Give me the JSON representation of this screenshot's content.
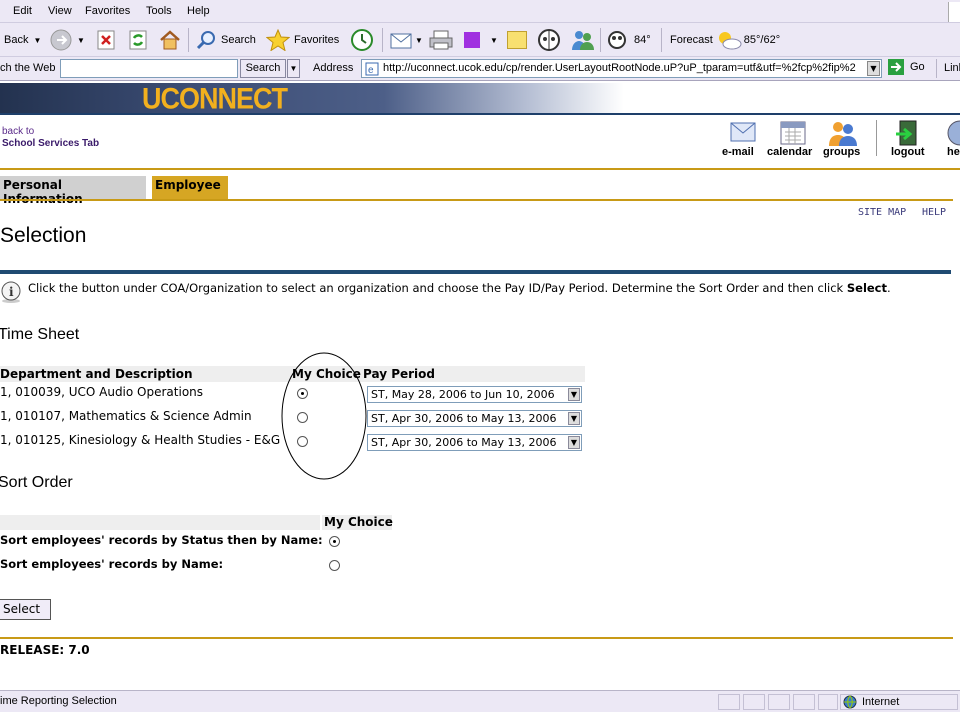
{
  "menu": [
    "Edit",
    "View",
    "Favorites",
    "Tools",
    "Help"
  ],
  "toolbar": {
    "back": "Back",
    "search": "Search",
    "favorites": "Favorites",
    "temp": "84°",
    "forecast": "Forecast",
    "forecast_temp": "85°/62°"
  },
  "addressbar": {
    "search_web": "ch the Web",
    "search_button": "Search",
    "address_label": "Address",
    "url": "http://uconnect.ucok.edu/cp/render.UserLayoutRootNode.uP?uP_tparam=utf&utf=%2fcp%2fip%2",
    "go": "Go",
    "links": "Link"
  },
  "banner": {
    "logo_text": "UCONNECT"
  },
  "back_link": {
    "line1": "back to",
    "line2": "School Services Tab"
  },
  "nav": [
    "e-mail",
    "calendar",
    "groups",
    "logout",
    "he"
  ],
  "tabs": [
    "Personal Information",
    "Employee"
  ],
  "top_links": {
    "site_map": "SITE MAP",
    "help": "HELP"
  },
  "page_title": "Selection",
  "info": {
    "text": "Click the button under COA/Organization to select an organization and choose the Pay ID/Pay Period. Determine the Sort Order and then click ",
    "bold": "Select",
    "end": "."
  },
  "timesheet": {
    "title": "Time Sheet",
    "headers": {
      "dept": "Department and Description",
      "choice": "My Choice",
      "period": "Pay Period"
    },
    "rows": [
      {
        "dept": "1, 010039, UCO Audio Operations",
        "period": "ST, May 28, 2006 to Jun 10, 2006",
        "selected": true
      },
      {
        "dept": "1, 010107, Mathematics & Science Admin",
        "period": "ST, Apr 30, 2006 to May 13, 2006",
        "selected": false
      },
      {
        "dept": "1, 010125, Kinesiology & Health Studies - E&G",
        "period": "ST, Apr 30, 2006 to May 13, 2006",
        "selected": false
      }
    ]
  },
  "sort": {
    "title": "Sort Order",
    "header": "My Choice",
    "rows": [
      {
        "label": "Sort employees' records by Status then by Name:",
        "selected": true
      },
      {
        "label": "Sort employees' records by Name:",
        "selected": false
      }
    ]
  },
  "select_button": "Select",
  "release": "RELEASE: 7.0",
  "status": {
    "text": "ime Reporting Selection",
    "zone": "Internet"
  }
}
